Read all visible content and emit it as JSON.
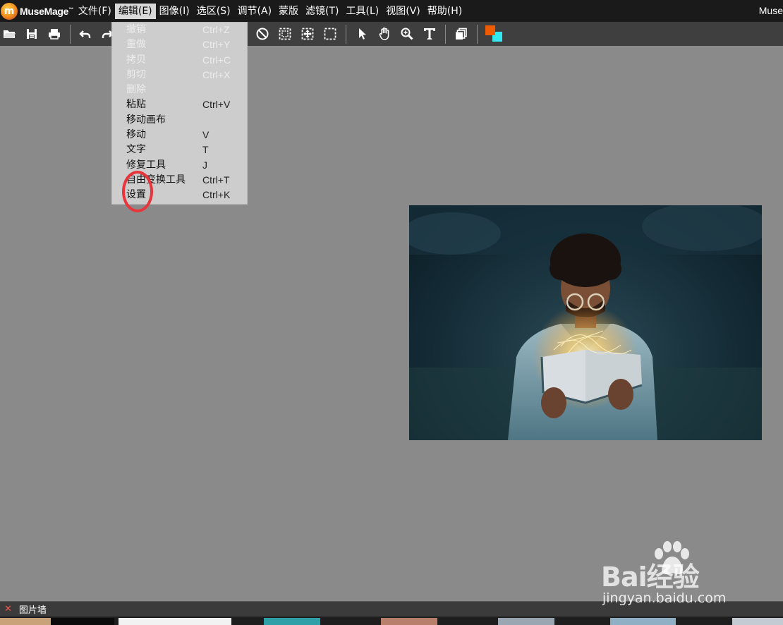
{
  "app": {
    "logo_letter": "m",
    "logo_text": "MuseMage",
    "logo_tm": "™",
    "window_title": "Muse"
  },
  "menubar": {
    "items": [
      {
        "label": "文件(F)"
      },
      {
        "label": "编辑(E)"
      },
      {
        "label": "图像(I)"
      },
      {
        "label": "选区(S)"
      },
      {
        "label": "调节(A)"
      },
      {
        "label": "蒙版"
      },
      {
        "label": "滤镜(T)"
      },
      {
        "label": "工具(L)"
      },
      {
        "label": "视图(V)"
      },
      {
        "label": "帮助(H)"
      }
    ]
  },
  "toolbar": {
    "icons": [
      "open-folder-icon",
      "save-icon",
      "print-icon",
      "undo-icon",
      "redo-icon",
      "deselect-icon",
      "select-all-icon",
      "select-grow-icon",
      "select-rect-icon",
      "pointer-icon",
      "hand-icon",
      "zoom-icon",
      "text-tool-icon",
      "layers-icon"
    ],
    "foreground_color": "#f05a00",
    "background_color": "#33e8f0"
  },
  "edit_menu": {
    "items": [
      {
        "label": "撤销",
        "shortcut": "Ctrl+Z",
        "enabled": false
      },
      {
        "label": "重做",
        "shortcut": "Ctrl+Y",
        "enabled": false
      },
      {
        "label": "拷贝",
        "shortcut": "Ctrl+C",
        "enabled": false
      },
      {
        "label": "剪切",
        "shortcut": "Ctrl+X",
        "enabled": false
      },
      {
        "label": "删除",
        "shortcut": "",
        "enabled": false
      },
      {
        "label": "粘贴",
        "shortcut": "Ctrl+V",
        "enabled": true
      },
      {
        "label": "移动画布",
        "shortcut": "",
        "enabled": true
      },
      {
        "label": "移动",
        "shortcut": "V",
        "enabled": true
      },
      {
        "label": "文字",
        "shortcut": "T",
        "enabled": true
      },
      {
        "label": "修复工具",
        "shortcut": "J",
        "enabled": true
      },
      {
        "label": "自由变换工具",
        "shortcut": "Ctrl+T",
        "enabled": true
      },
      {
        "label": "设置",
        "shortcut": "Ctrl+K",
        "enabled": true
      }
    ]
  },
  "bottom_panel": {
    "close_glyph": "✕",
    "title": "图片墙"
  },
  "watermark": {
    "main": "Bai经验",
    "sub": "jingyan.baidu.com"
  }
}
